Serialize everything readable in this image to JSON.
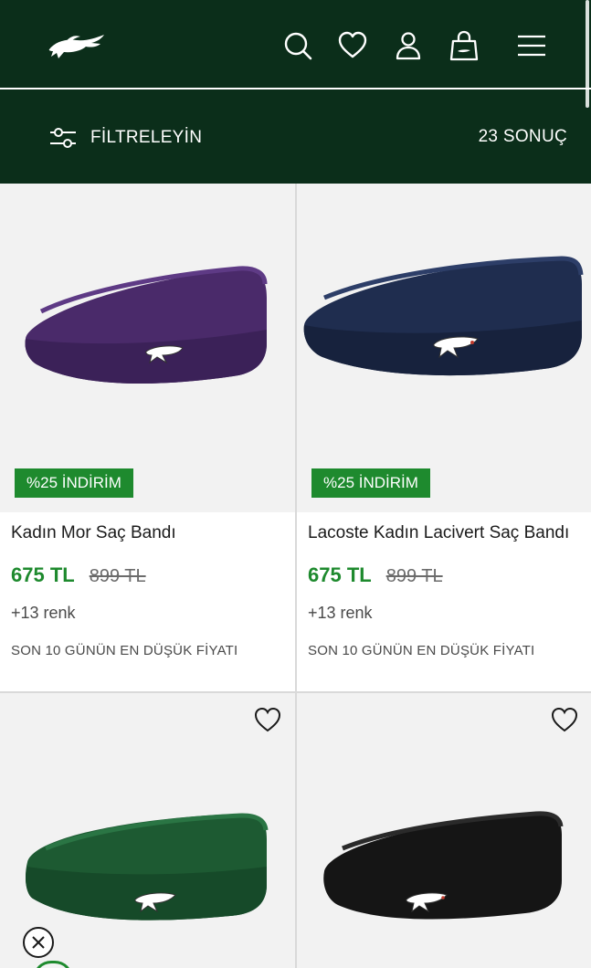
{
  "header": {
    "icons": [
      "lacoste-crocodile-logo",
      "search-icon",
      "heart-icon",
      "user-icon",
      "shopping-bag-icon",
      "hamburger-menu-icon"
    ]
  },
  "filter": {
    "label": "FİLTRELEYİN",
    "result_count": "23 SONUÇ"
  },
  "colors": {
    "header_bg": "#0b2e1a",
    "accent_green": "#1e8a2e",
    "image_bg": "#f2f2f2"
  },
  "products": [
    {
      "badge": "%25 İNDİRİM",
      "title": "Kadın Mor Saç Bandı",
      "price": "675 TL",
      "old_price": "899 TL",
      "colors_count": "+13 renk",
      "lowest_price_note": "SON 10 GÜNÜN EN DÜŞÜK FİYATI",
      "image_color": "#4a2a6a"
    },
    {
      "badge": "%25 İNDİRİM",
      "title": "Lacoste Kadın Lacivert Saç Bandı",
      "price": "675 TL",
      "old_price": "899 TL",
      "colors_count": "+13 renk",
      "lowest_price_note": "SON 10 GÜNÜN EN DÜŞÜK FİYATI",
      "image_color": "#1f2d4f"
    },
    {
      "image_color": "#1d5a32"
    },
    {
      "image_color": "#151515"
    }
  ]
}
